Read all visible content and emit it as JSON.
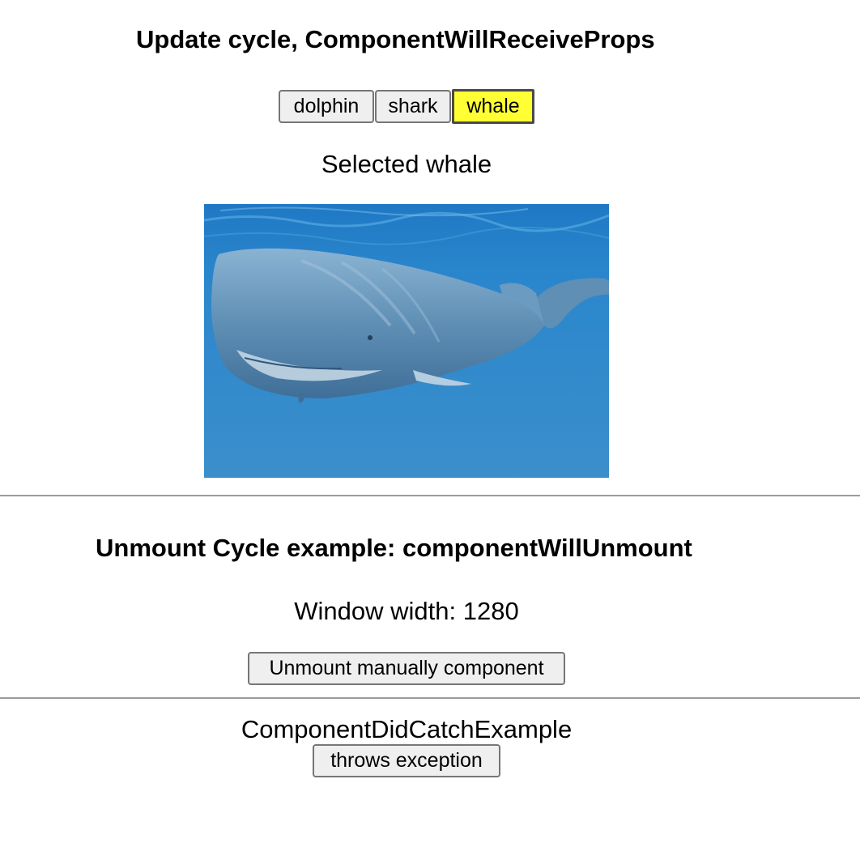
{
  "update_section": {
    "title": "Update cycle, ComponentWillReceiveProps",
    "buttons": [
      {
        "label": "dolphin",
        "selected": false
      },
      {
        "label": "shark",
        "selected": false
      },
      {
        "label": "whale",
        "selected": true
      }
    ],
    "selected_text": "Selected whale",
    "image_subject": "sperm whale underwater photo",
    "selected_color": "#ffff33"
  },
  "unmount_section": {
    "title": "Unmount Cycle example: componentWillUnmount",
    "window_width_text": "Window width: 1280",
    "unmount_button_label": "Unmount manually component"
  },
  "catch_section": {
    "title": "ComponentDidCatchExample",
    "throw_button_label": "throws exception"
  }
}
